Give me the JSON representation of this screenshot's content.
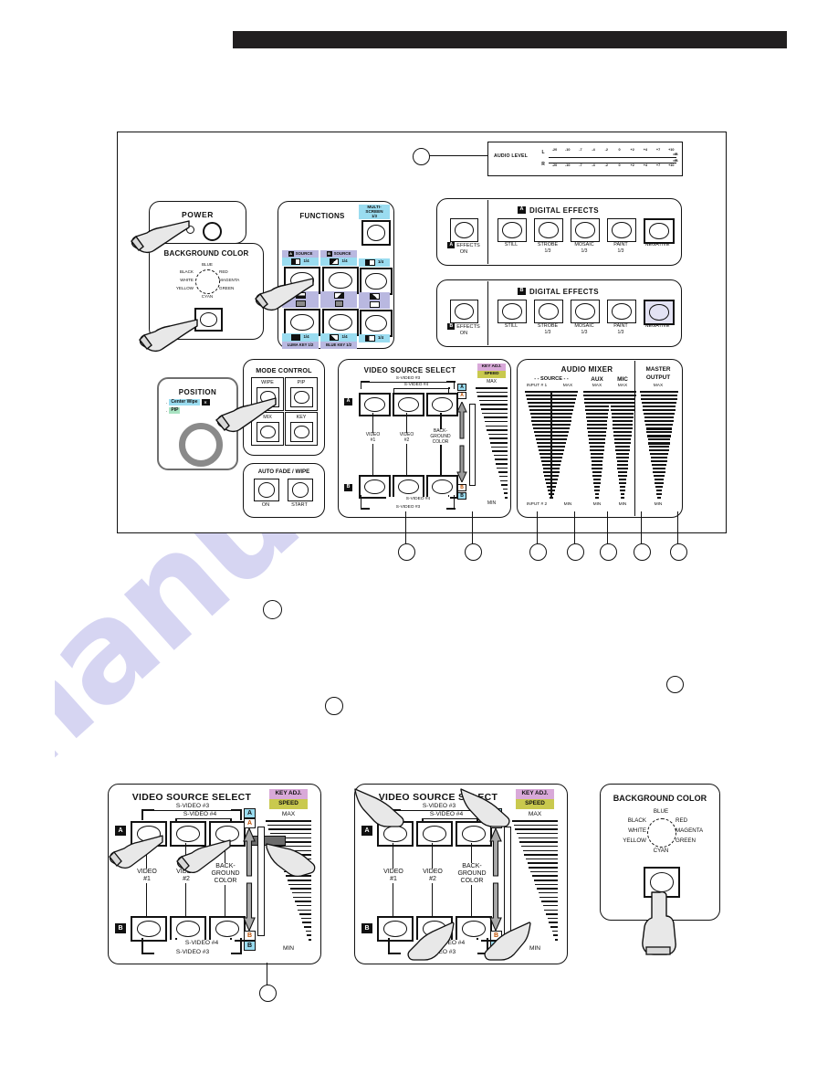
{
  "document": {
    "type": "product-control-panel-diagram",
    "watermark_text": "manualshive.c"
  },
  "audio_level": {
    "title": "AUDIO LEVEL",
    "channels": [
      "L",
      "R"
    ],
    "unit": "dB",
    "scale": [
      "-20",
      "-10",
      "-7",
      "-4",
      "-2",
      "0",
      "+2",
      "+4",
      "+7",
      "+10"
    ]
  },
  "power": {
    "title": "POWER"
  },
  "background_color": {
    "title": "BACKGROUND COLOR",
    "dial_labels": [
      "BLUE",
      "BLACK",
      "RED",
      "WHITE",
      "MAGENTA",
      "YELLOW",
      "GREEN",
      "CYAN"
    ]
  },
  "functions": {
    "title": "FUNCTIONS",
    "multiscreen": {
      "label": "MULTI-\nSCREEN",
      "page": "1/3"
    },
    "columns": [
      {
        "header": "SOURCE",
        "header_badge": "A",
        "top_page": "1/4",
        "bottom_page": "1/4",
        "footer": "LUMA KEY 1/2"
      },
      {
        "header": "SOURCE",
        "header_badge": "B",
        "top_page": "1/4",
        "bottom_page": "1/4",
        "footer": "BLUE KEY 1/2"
      },
      {
        "header": "",
        "header_badge": "",
        "top_page": "1/4",
        "bottom_page": "1/4",
        "footer": ""
      }
    ]
  },
  "digital_effects_a": {
    "badge": "A",
    "title": "DIGITAL EFFECTS",
    "on_label": "EFFECTS",
    "on_label2": "ON",
    "on_badge": "A",
    "effects": [
      {
        "name": "STILL",
        "page": ""
      },
      {
        "name": "STROBE",
        "page": "1/3"
      },
      {
        "name": "MOSAIC",
        "page": "1/3"
      },
      {
        "name": "PAINT",
        "page": "1/3"
      },
      {
        "name": "NEGATIVE",
        "page": ""
      }
    ]
  },
  "digital_effects_b": {
    "badge": "B",
    "title": "DIGITAL EFFECTS",
    "on_label": "EFFECTS",
    "on_label2": "ON",
    "on_badge": "B",
    "effects": [
      {
        "name": "STILL",
        "page": ""
      },
      {
        "name": "STROBE",
        "page": "1/3"
      },
      {
        "name": "MOSAIC",
        "page": "1/3"
      },
      {
        "name": "PAINT",
        "page": "1/3"
      },
      {
        "name": "NEGATIVE",
        "page": ""
      }
    ]
  },
  "position": {
    "title": "POSITION",
    "option1": "Center Wipe",
    "option2": "PIP"
  },
  "mode_control": {
    "title": "MODE CONTROL",
    "buttons": [
      "WIPE",
      "PIP",
      "MIX",
      "KEY"
    ]
  },
  "auto_fade": {
    "title": "AUTO FADE / WIPE",
    "buttons": [
      "ON",
      "START"
    ]
  },
  "video_source_select": {
    "title": "VIDEO SOURCE SELECT",
    "row_a_badge": "A",
    "row_b_badge": "B",
    "columns": [
      "VIDEO\n#1",
      "VIDEO\n#2",
      "BACK-\nGROUND\nCOLOR"
    ],
    "top_bracket_1": "S-VIDEO #3",
    "top_bracket_2": "S-VIDEO #4",
    "bottom_bracket_1": "S-VIDEO #4",
    "bottom_bracket_2": "S-VIDEO #3",
    "key_adj": "KEY ADJ.",
    "speed": "SPEED",
    "max": "MAX",
    "min": "MIN"
  },
  "audio_mixer": {
    "title": "AUDIO MIXER",
    "source_label": "- - SOURCE - -",
    "input1": "INPUT # 1",
    "input2": "INPUT # 2",
    "channels": [
      {
        "name": "AUX",
        "max": "MAX",
        "min": "MIN"
      },
      {
        "name": "MIC",
        "max": "MAX",
        "min": "MIN"
      }
    ],
    "source_max": "MAX",
    "source_min": "MIN",
    "master": {
      "line1": "MASTER",
      "line2": "OUTPUT",
      "max": "MAX",
      "min": "MIN"
    }
  },
  "bottom_panels": {
    "panel1": {
      "title": "VIDEO SOURCE SELECT",
      "row_a_badge": "A",
      "row_b_badge": "B",
      "columns": [
        "VIDEO\n#1",
        "VIDEO\n#2",
        "BACK-\nGROUND\nCOLOR"
      ],
      "top_bracket_1": "S-VIDEO #3",
      "top_bracket_2": "S-VIDEO #4",
      "bottom_bracket_1": "S-VIDEO #4",
      "bottom_bracket_2": "S-VIDEO #3",
      "key_adj": "KEY ADJ.",
      "speed": "SPEED",
      "max": "MAX",
      "min": "MIN"
    },
    "panel2": {
      "title": "VIDEO SOURCE SELECT",
      "row_a_badge": "A",
      "row_b_badge": "B",
      "columns": [
        "VIDEO\n#1",
        "VIDEO\n#2",
        "BACK-\nGROUND\nCOLOR"
      ],
      "top_bracket_1": "S-VIDEO #3",
      "top_bracket_2": "S-VIDEO #4",
      "bottom_bracket_1": "S-VIDEO #4",
      "bottom_bracket_2": "S-VIDEO #3",
      "key_adj": "KEY ADJ.",
      "speed": "SPEED",
      "max": "MAX",
      "min": "MIN"
    },
    "panel3": {
      "title": "BACKGROUND COLOR",
      "dial_labels": [
        "BLUE",
        "BLACK",
        "RED",
        "WHITE",
        "MAGENTA",
        "YELLOW",
        "GREEN",
        "CYAN"
      ]
    }
  }
}
